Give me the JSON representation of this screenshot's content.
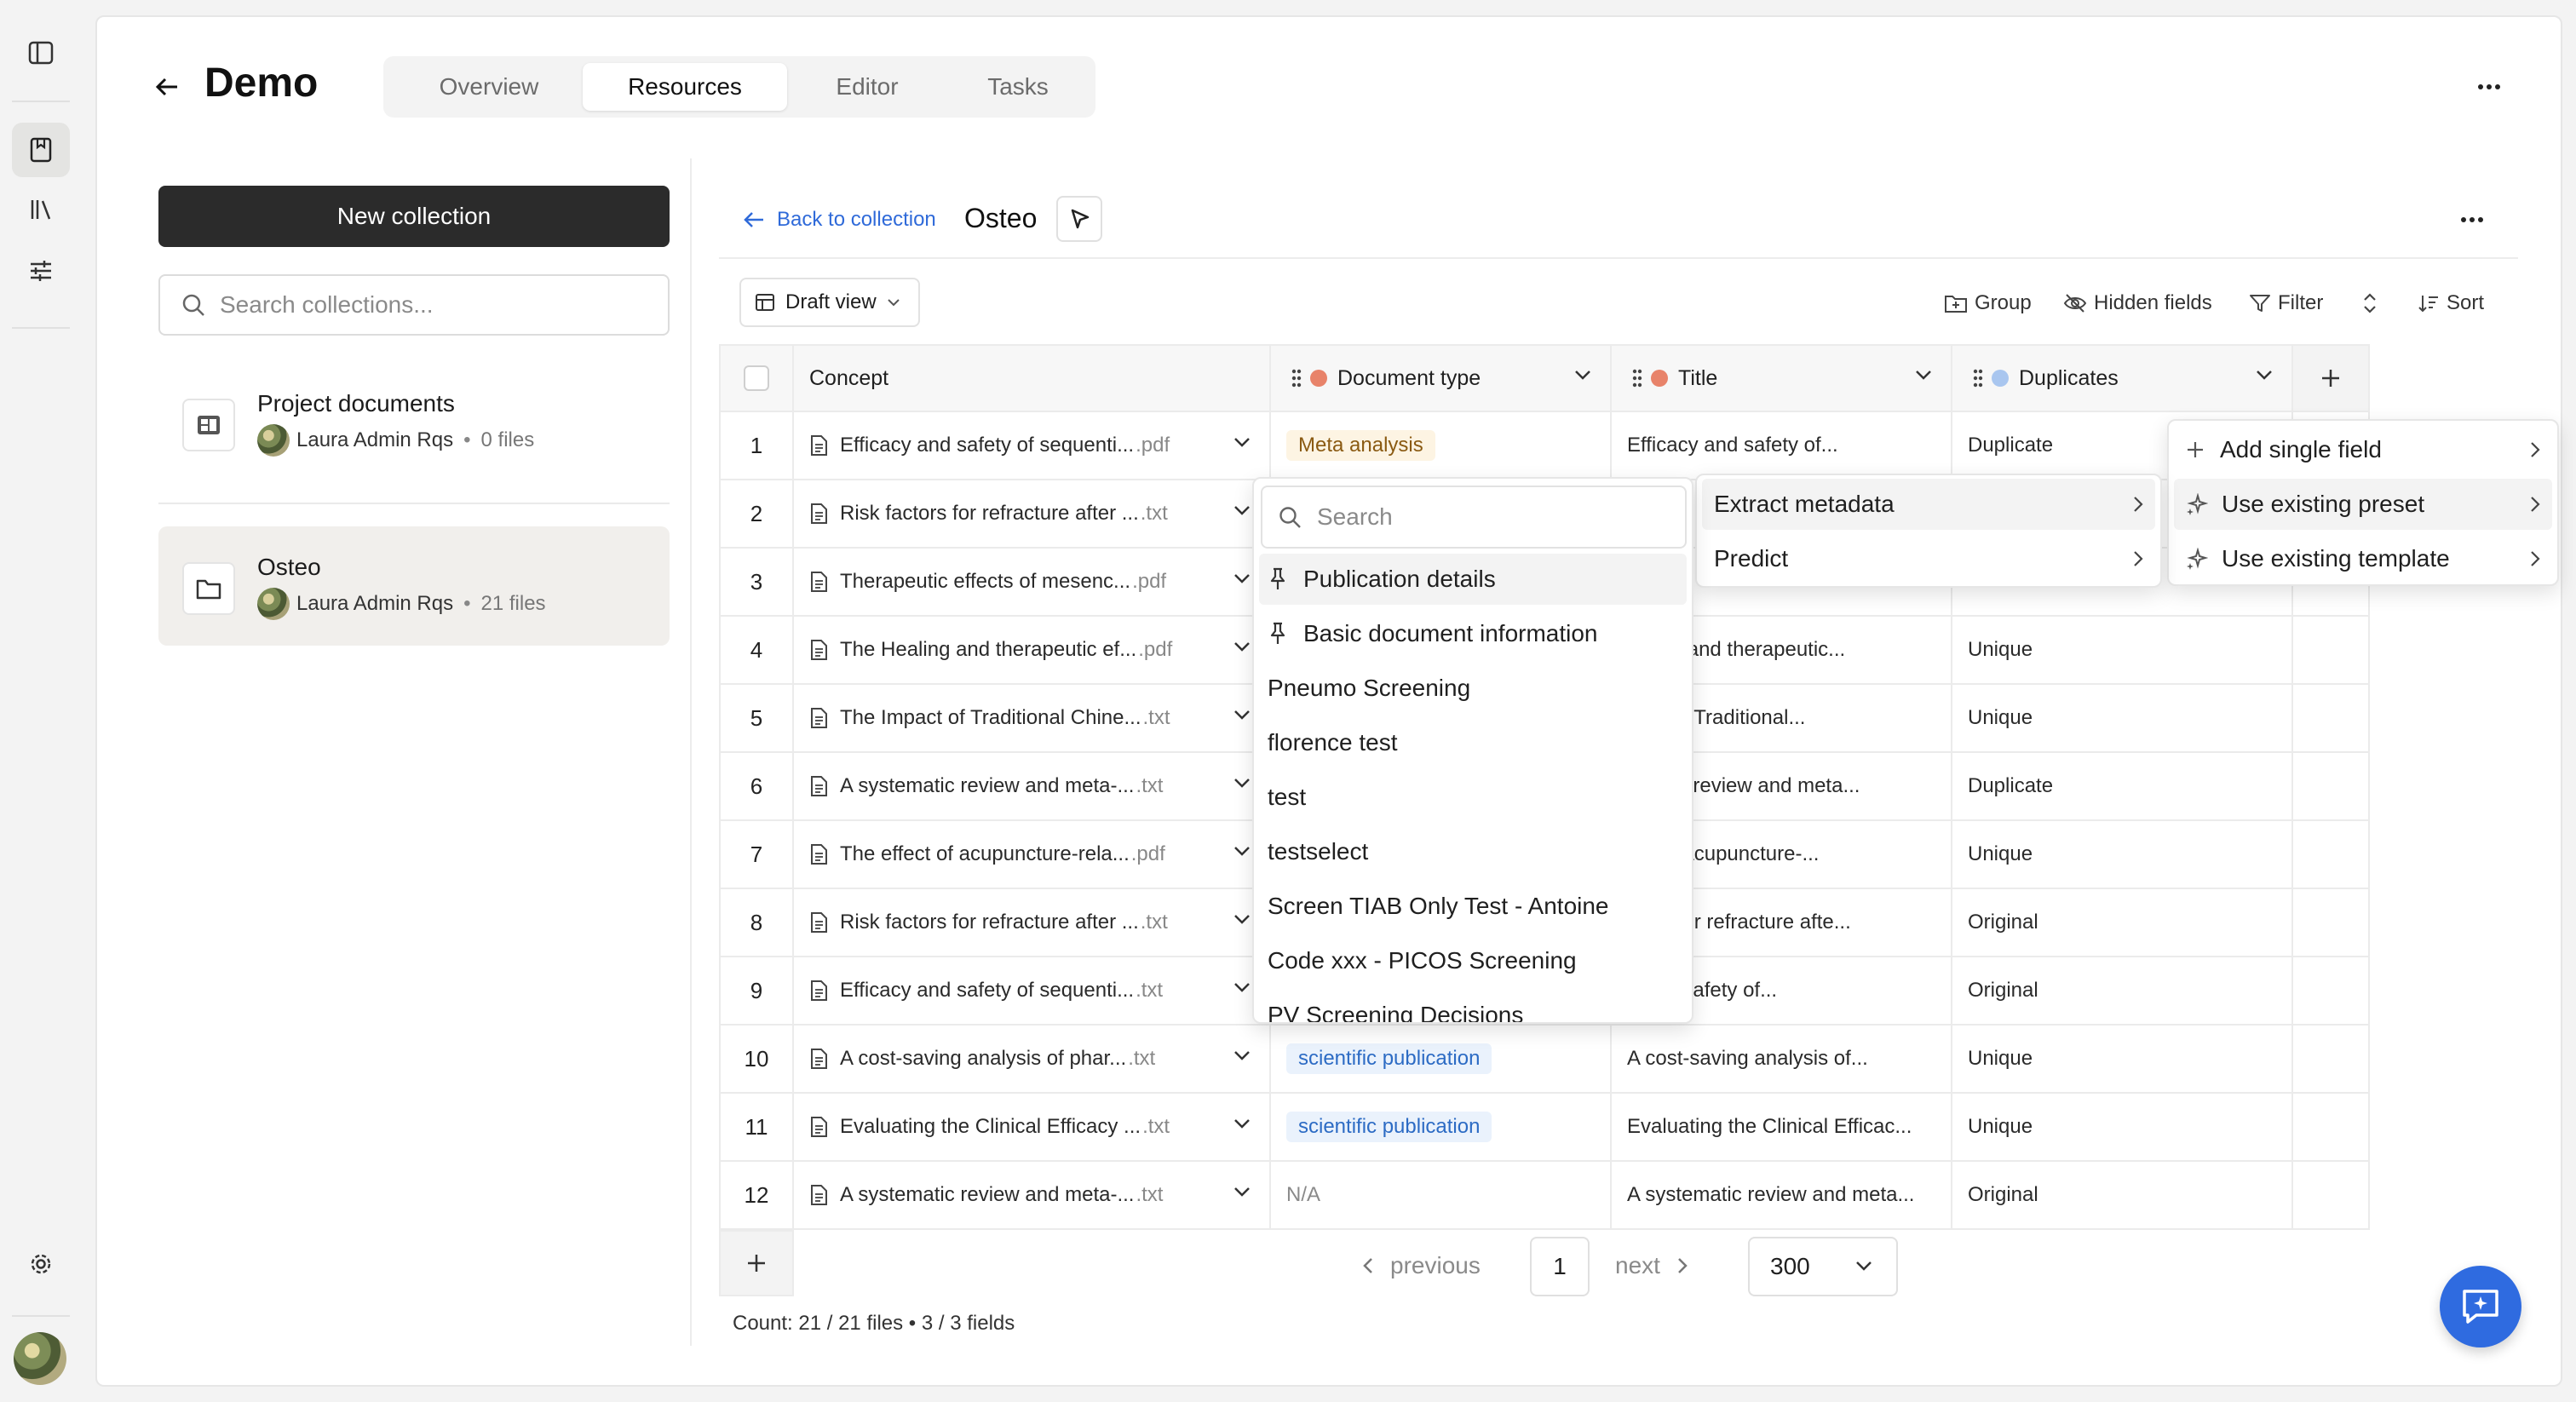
{
  "app": {
    "title": "Demo",
    "tabs": [
      {
        "label": "Overview",
        "active": false
      },
      {
        "label": "Resources",
        "active": true
      },
      {
        "label": "Editor",
        "active": false
      },
      {
        "label": "Tasks",
        "active": false
      }
    ]
  },
  "rail": {
    "icons": [
      "sidebar-toggle-icon",
      "book-icon",
      "library-icon",
      "sliders-icon",
      "settings-icon",
      "user-avatar"
    ]
  },
  "sidebar": {
    "new_collection_label": "New collection",
    "search_placeholder": "Search collections...",
    "collections": [
      {
        "name": "Project documents",
        "owner": "Laura Admin Rqs",
        "files": "0 files",
        "active": false
      },
      {
        "name": "Osteo",
        "owner": "Laura Admin Rqs",
        "files": "21 files",
        "active": true
      }
    ]
  },
  "content": {
    "back_label": "Back to collection",
    "collection_title": "Osteo",
    "view_label": "Draft view",
    "toolbar": {
      "group": "Group",
      "hidden_fields": "Hidden fields",
      "filter": "Filter",
      "sort": "Sort"
    }
  },
  "table": {
    "columns": [
      "Concept",
      "Document type",
      "Title",
      "Duplicates"
    ],
    "column_icon_colors": {
      "Document type": "#e8836a",
      "Title": "#e8836a",
      "Duplicates": "#a9c6ef"
    },
    "rows": [
      {
        "n": "1",
        "concept": "Efficacy and safety of sequenti...",
        "ext": ".pdf",
        "doctype": "Meta analysis",
        "doctype_style": "meta",
        "title": "Efficacy and safety of...",
        "dup": "Duplicate"
      },
      {
        "n": "2",
        "concept": "Risk factors for refracture after ...",
        "ext": ".txt",
        "doctype": "",
        "doctype_style": "",
        "title": "",
        "dup": ""
      },
      {
        "n": "3",
        "concept": "Therapeutic effects of mesenc...",
        "ext": ".pdf",
        "doctype": "",
        "doctype_style": "",
        "title": "",
        "dup": ""
      },
      {
        "n": "4",
        "concept": "The Healing and therapeutic ef...",
        "ext": ".pdf",
        "doctype": "",
        "doctype_style": "",
        "title": "ealing and therapeutic...",
        "dup": "Unique"
      },
      {
        "n": "5",
        "concept": "The Impact of Traditional Chine...",
        "ext": ".txt",
        "doctype": "",
        "doctype_style": "",
        "title": "pact of Traditional...",
        "dup": "Unique"
      },
      {
        "n": "6",
        "concept": "A systematic review and meta-...",
        "ext": ".txt",
        "doctype": "",
        "doctype_style": "",
        "title": "ematic review and meta...",
        "dup": "Duplicate"
      },
      {
        "n": "7",
        "concept": "The effect of acupuncture-rela...",
        "ext": ".pdf",
        "doctype": "",
        "doctype_style": "",
        "title": "ect of acupuncture-...",
        "dup": "Unique"
      },
      {
        "n": "8",
        "concept": "Risk factors for refracture after ...",
        "ext": ".txt",
        "doctype": "",
        "doctype_style": "",
        "title": "ctors for refracture afte...",
        "dup": "Original"
      },
      {
        "n": "9",
        "concept": "Efficacy and safety of sequenti...",
        "ext": ".txt",
        "doctype": "",
        "doctype_style": "",
        "title": "y and safety of...",
        "dup": "Original"
      },
      {
        "n": "10",
        "concept": "A cost-saving analysis of phar...",
        "ext": ".txt",
        "doctype": "scientific publication",
        "doctype_style": "sci",
        "title": "A cost-saving analysis of...",
        "dup": "Unique"
      },
      {
        "n": "11",
        "concept": "Evaluating the Clinical Efficacy ...",
        "ext": ".txt",
        "doctype": "scientific publication",
        "doctype_style": "sci",
        "title": "Evaluating the Clinical Efficac...",
        "dup": "Unique"
      },
      {
        "n": "12",
        "concept": "A systematic review and meta-...",
        "ext": ".txt",
        "doctype": "N/A",
        "doctype_style": "na",
        "title": "A systematic review and meta...",
        "dup": "Original"
      }
    ]
  },
  "pager": {
    "previous": "previous",
    "page": "1",
    "next": "next",
    "page_size": "300",
    "count": "Count: 21 / 21 files • 3 / 3 fields"
  },
  "menus": {
    "add_field": [
      {
        "label": "Add single field",
        "icon": "plus-icon"
      },
      {
        "label": "Use existing preset",
        "icon": "sparkles-icon",
        "highlighted": true
      },
      {
        "label": "Use existing template",
        "icon": "sparkles-icon"
      }
    ],
    "preset_actions": [
      {
        "label": "Extract metadata",
        "highlighted": true
      },
      {
        "label": "Predict"
      }
    ],
    "preset_search_placeholder": "Search",
    "presets": [
      {
        "label": "Publication details",
        "pinned": true,
        "highlighted": true
      },
      {
        "label": "Basic document information",
        "pinned": true
      },
      {
        "label": "Pneumo Screening"
      },
      {
        "label": "florence test"
      },
      {
        "label": "test"
      },
      {
        "label": "testselect"
      },
      {
        "label": "Screen TIAB Only Test - Antoine"
      },
      {
        "label": "Code xxx - PICOS Screening"
      },
      {
        "label": "PV Screening Decisions"
      }
    ]
  }
}
